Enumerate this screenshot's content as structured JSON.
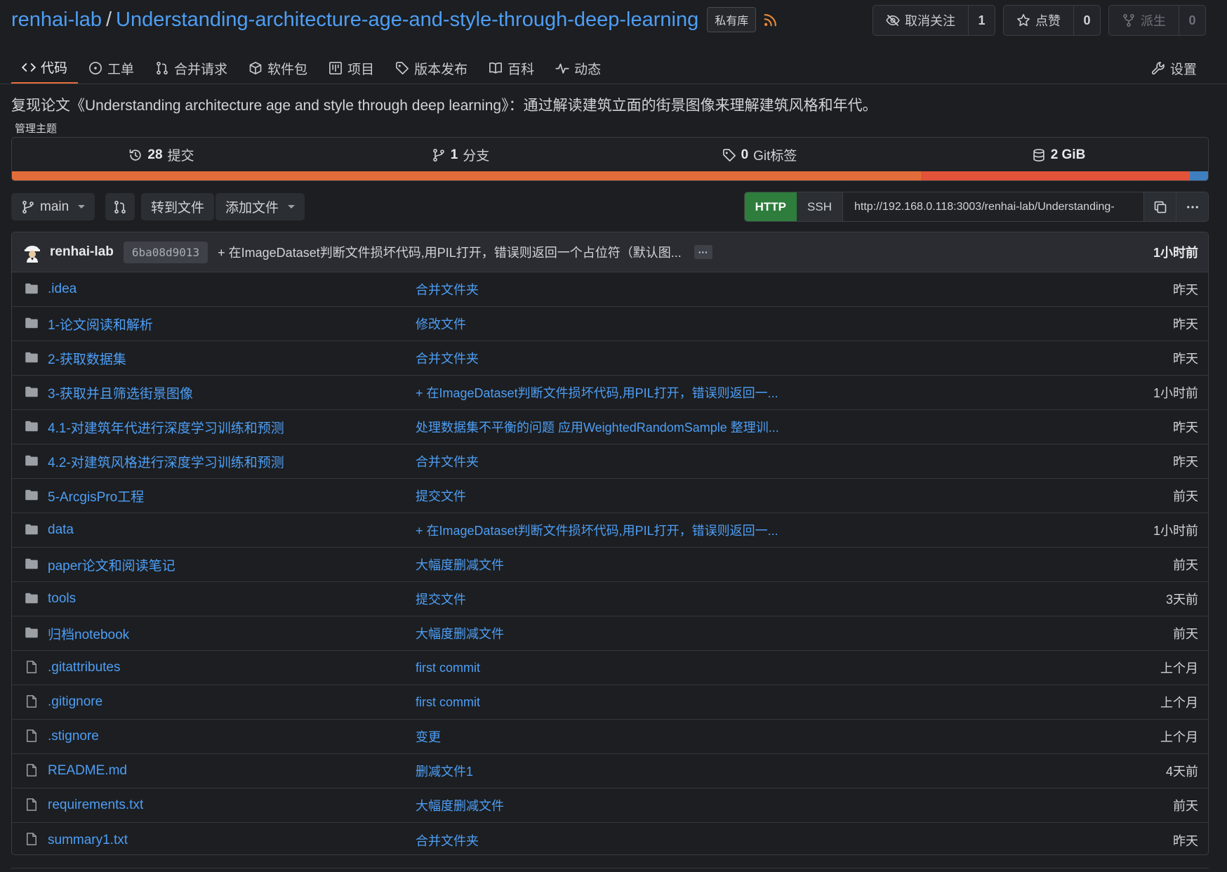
{
  "repo": {
    "owner": "renhai-lab",
    "separator": "/",
    "name": "Understanding-architecture-age-and-style-through-deep-learning",
    "visibility": "私有库"
  },
  "actions": [
    {
      "label": "取消关注",
      "count": "1",
      "icon": "eye-off-icon"
    },
    {
      "label": "点赞",
      "count": "0",
      "icon": "star-icon"
    },
    {
      "label": "派生",
      "count": "0",
      "icon": "fork-icon"
    }
  ],
  "tabs": [
    {
      "label": "代码",
      "icon": "code-icon",
      "active": true
    },
    {
      "label": "工单",
      "icon": "issue-icon"
    },
    {
      "label": "合并请求",
      "icon": "pull-request-icon"
    },
    {
      "label": "软件包",
      "icon": "package-icon"
    },
    {
      "label": "项目",
      "icon": "project-icon"
    },
    {
      "label": "版本发布",
      "icon": "tag-icon"
    },
    {
      "label": "百科",
      "icon": "book-icon"
    },
    {
      "label": "动态",
      "icon": "pulse-icon"
    }
  ],
  "settings_label": "设置",
  "description": "复现论文《Understanding architecture age and style through deep learning》：通过解读建筑立面的街景图像来理解建筑风格和年代。",
  "manage_topics": "管理主题",
  "stats": {
    "commits_count": "28",
    "commits_label": "提交",
    "branches_count": "1",
    "branches_label": "分支",
    "tags_count": "0",
    "tags_label": "Git标签",
    "size": "2 GiB"
  },
  "language_bar": [
    {
      "color": "#e36d3a",
      "fraction": 0.76
    },
    {
      "color": "#e3533a",
      "fraction": 0.225
    },
    {
      "color": "#3f7fbf",
      "fraction": 0.015
    }
  ],
  "toolbar": {
    "branch": "main",
    "goto_file": "转到文件",
    "add_file": "添加文件",
    "http": "HTTP",
    "ssh": "SSH",
    "clone_url": "http://192.168.0.118:3003/renhai-lab/Understanding-"
  },
  "latest_commit": {
    "author": "renhai-lab",
    "sha": "6ba08d9013",
    "message": "+ 在ImageDataset判断文件损坏代码,用PIL打开，错误则返回一个占位符（默认图...",
    "more": "···",
    "time": "1小时前"
  },
  "files": [
    {
      "name": ".idea",
      "type": "folder",
      "message": "合并文件夹",
      "time": "昨天"
    },
    {
      "name": "1-论文阅读和解析",
      "type": "folder",
      "message": "修改文件",
      "time": "昨天"
    },
    {
      "name": "2-获取数据集",
      "type": "folder",
      "message": "合并文件夹",
      "time": "昨天"
    },
    {
      "name": "3-获取并且筛选街景图像",
      "type": "folder",
      "message": "+ 在ImageDataset判断文件损坏代码,用PIL打开，错误则返回一...",
      "time": "1小时前"
    },
    {
      "name": "4.1-对建筑年代进行深度学习训练和预测",
      "type": "folder",
      "message": "处理数据集不平衡的问题 应用WeightedRandomSample 整理训...",
      "time": "昨天"
    },
    {
      "name": "4.2-对建筑风格进行深度学习训练和预测",
      "type": "folder",
      "message": "合并文件夹",
      "time": "昨天"
    },
    {
      "name": "5-ArcgisPro工程",
      "type": "folder",
      "message": "提交文件",
      "time": "前天"
    },
    {
      "name": "data",
      "type": "folder",
      "message": "+ 在ImageDataset判断文件损坏代码,用PIL打开，错误则返回一...",
      "time": "1小时前"
    },
    {
      "name": "paper论文和阅读笔记",
      "type": "folder",
      "message": "大幅度删减文件",
      "time": "前天"
    },
    {
      "name": "tools",
      "type": "folder",
      "message": "提交文件",
      "time": "3天前"
    },
    {
      "name": "归档notebook",
      "type": "folder",
      "message": "大幅度删减文件",
      "time": "前天"
    },
    {
      "name": ".gitattributes",
      "type": "file",
      "message": "first commit",
      "time": "上个月"
    },
    {
      "name": ".gitignore",
      "type": "file",
      "message": "first commit",
      "time": "上个月"
    },
    {
      "name": ".stignore",
      "type": "file",
      "message": "变更",
      "time": "上个月"
    },
    {
      "name": "README.md",
      "type": "file",
      "message": "删减文件1",
      "time": "4天前"
    },
    {
      "name": "requirements.txt",
      "type": "file",
      "message": "大幅度删减文件",
      "time": "前天"
    },
    {
      "name": "summary1.txt",
      "type": "file",
      "message": "合并文件夹",
      "time": "昨天"
    }
  ]
}
